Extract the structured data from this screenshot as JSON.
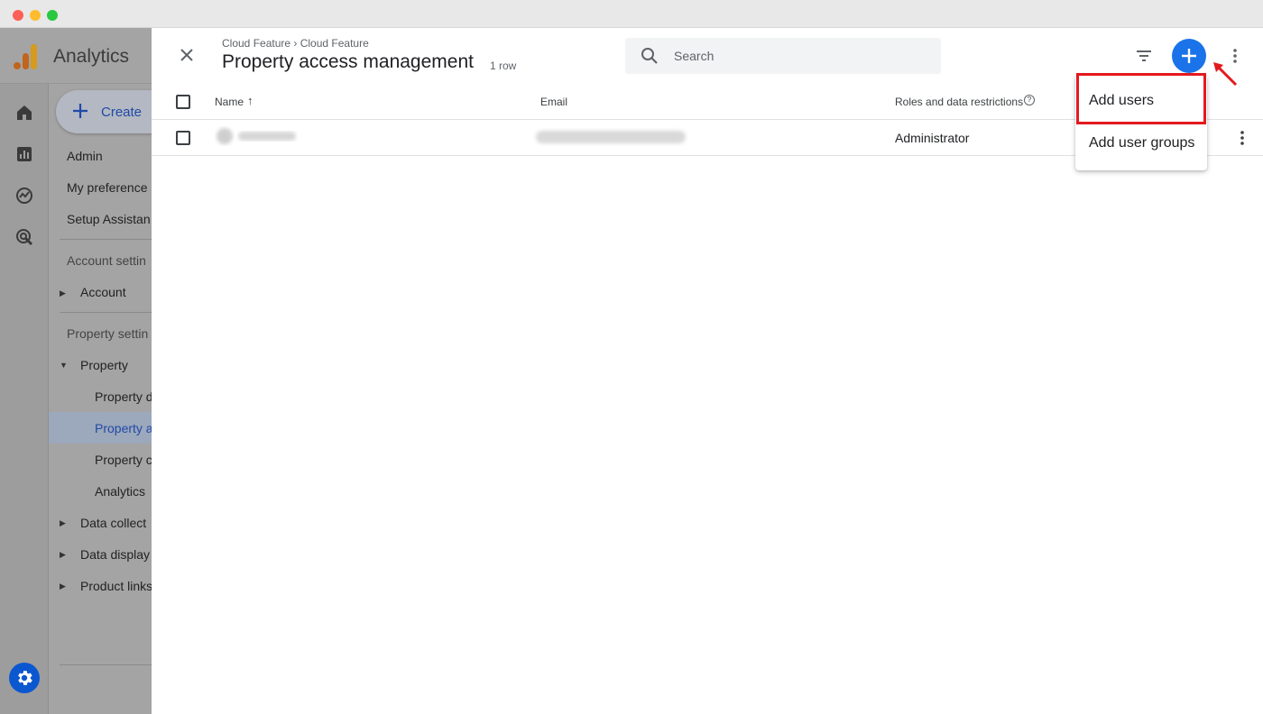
{
  "app": {
    "name": "Analytics"
  },
  "nav": {
    "create_label": "Create",
    "items": {
      "admin": "Admin",
      "my_preferences": "My preference",
      "setup_assistant": "Setup Assistan",
      "account_settings": "Account settin",
      "account": "Account",
      "property_settings": "Property settin",
      "property": "Property",
      "property_details": "Property d",
      "property_access": "Property a",
      "property_change": "Property c",
      "analytics": "Analytics",
      "data_collection": "Data collect",
      "data_display": "Data display",
      "product_links": "Product links"
    }
  },
  "header": {
    "breadcrumb": "Cloud Feature › Cloud Feature",
    "title": "Property access management",
    "row_count": "1 row",
    "search_placeholder": "Search"
  },
  "table": {
    "columns": {
      "name": "Name",
      "name_sort": "↑",
      "email": "Email",
      "roles": "Roles and data restrictions",
      "roles_help": "?"
    },
    "rows": [
      {
        "role": "Administrator"
      }
    ]
  },
  "menu": {
    "items": [
      "Add users",
      "Add user groups"
    ]
  },
  "colors": {
    "accent": "#1a73e8",
    "highlight": "#e4191e"
  },
  "icons": [
    "home-icon",
    "reports-icon",
    "explore-icon",
    "advertising-icon",
    "gear-icon",
    "close-icon",
    "search-icon",
    "filter-icon",
    "plus-icon",
    "more-vert-icon"
  ]
}
